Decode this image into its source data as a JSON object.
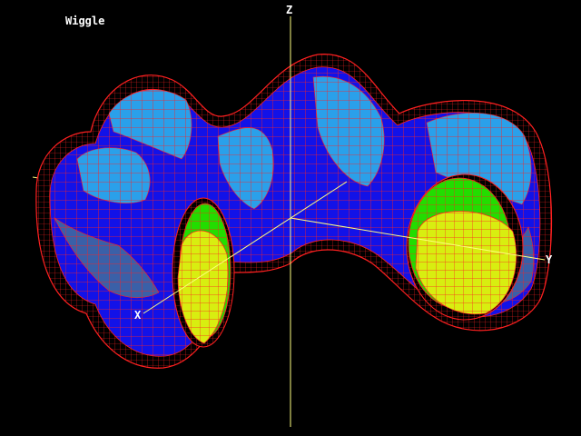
{
  "window": {
    "title": "Wiggle"
  },
  "axes": {
    "x": "X",
    "y": "Y",
    "z": "Z"
  },
  "colors": {
    "background": "#000000",
    "wireframe": "#ff2020",
    "axis": "#ffff80",
    "surface_dark": "#1010ee",
    "surface_light": "#2a9ee8",
    "surface_gray": "#3a5fa0",
    "inner_green": "#22dd00",
    "inner_yellow": "#ddee10",
    "label": "#ffffff"
  }
}
